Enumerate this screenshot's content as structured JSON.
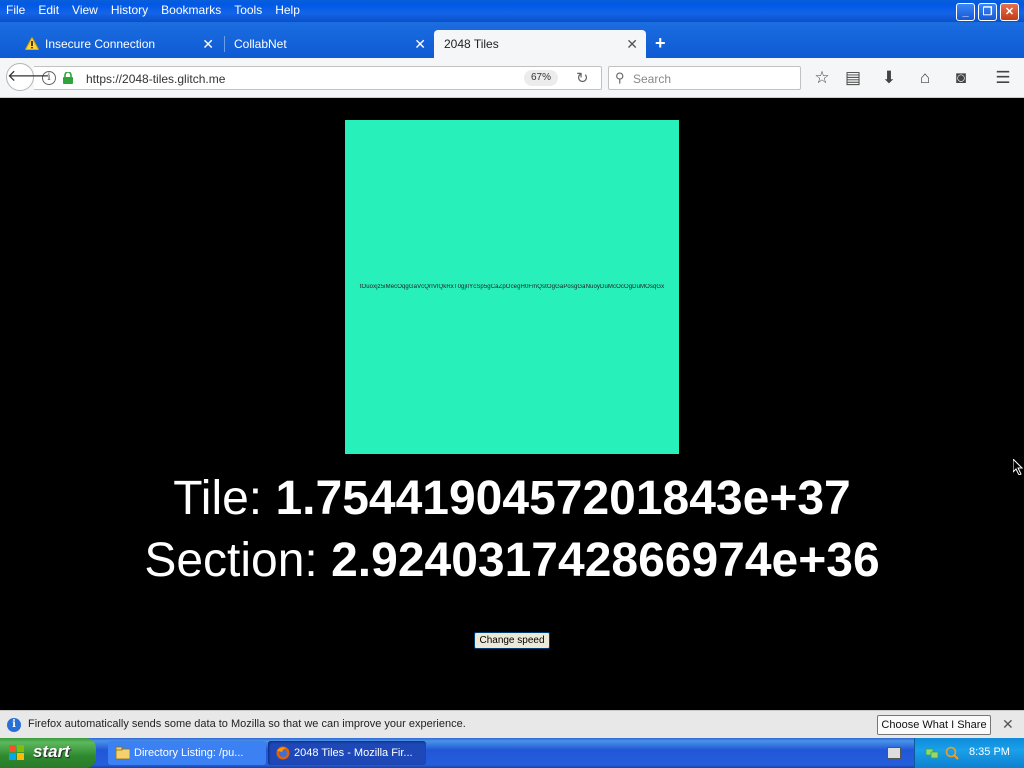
{
  "menu": {
    "items": [
      "File",
      "Edit",
      "View",
      "History",
      "Bookmarks",
      "Tools",
      "Help"
    ]
  },
  "tabs": [
    {
      "label": "Insecure Connection",
      "icon": "warning-icon"
    },
    {
      "label": "CollabNet"
    },
    {
      "label": "2048 Tiles",
      "active": true
    }
  ],
  "nav": {
    "url": "https://2048-tiles.glitch.me",
    "zoom": "67%",
    "search_placeholder": "Search"
  },
  "content": {
    "tile_color": "#27f0bb",
    "tile_text": "tOuoxjz5iMecOqgGaVcQrIVlQkRxT0gjlIYcSp5gCaZpOcegH0FmQstOgGaPosgGaNuoyDuMcOcOgDuMOsqGx",
    "tile_label": "Tile: ",
    "tile_value": "1.7544190457201843e+37",
    "section_label": "Section: ",
    "section_value": "2.924031742866974e+36",
    "speed_button": "Change speed"
  },
  "notification": {
    "text": "Firefox automatically sends some data to Mozilla so that we can improve your experience.",
    "button": "Choose What I Share"
  },
  "taskbar": {
    "start": "start",
    "tasks": [
      {
        "label": "Directory Listing: /pu..."
      },
      {
        "label": "2048 Tiles - Mozilla Fir..."
      }
    ],
    "clock": "8:35 PM"
  }
}
